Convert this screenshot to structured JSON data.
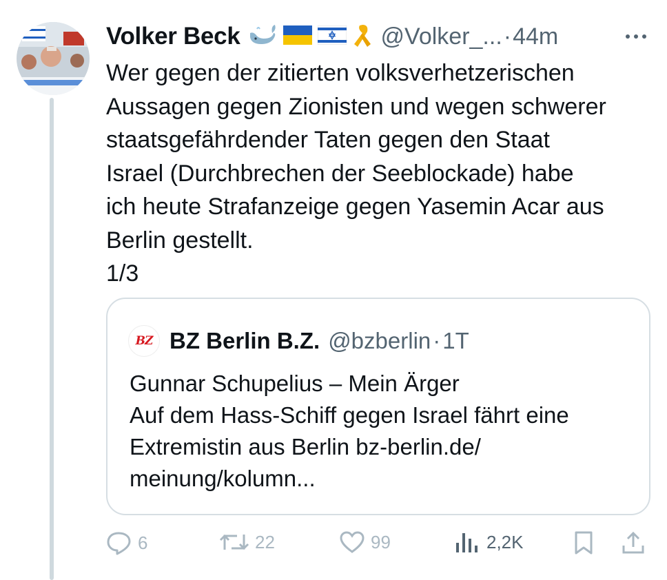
{
  "tweet": {
    "author_name": "Volker Beck",
    "badges": [
      "whale-emoji",
      "ukraine-flag",
      "israel-flag",
      "yellow-ribbon"
    ],
    "handle": "@Volker_...",
    "separator": "·",
    "time": "44m",
    "text": "Wer gegen der zitierten volksverhetzerischen\nAussagen gegen Zionisten und wegen schwerer\nstaatsgefährdender Taten gegen den Staat\nIsrael (Durchbrechen der Seeblockade) habe\nich heute Strafanzeige gegen Yasemin Acar aus\nBerlin gestellt.\n1/3"
  },
  "quote": {
    "logo_text": "BZ",
    "author_name": "BZ Berlin B.Z.",
    "handle": "@bzberlin",
    "separator": "·",
    "time": "1T",
    "text": "Gunnar Schupelius – Mein Ärger\nAuf dem Hass-Schiff gegen Israel fährt eine\nExtremistin aus Berlin bz-berlin.de/\nmeinung/kolumn..."
  },
  "actions": {
    "replies": "6",
    "retweets": "22",
    "likes": "99",
    "views": "2,2K"
  },
  "colors": {
    "text": "#0f1419",
    "muted": "#536471",
    "faded_actions": "#aab8c2",
    "border": "#d6dee3",
    "bz_red": "#d71920"
  }
}
